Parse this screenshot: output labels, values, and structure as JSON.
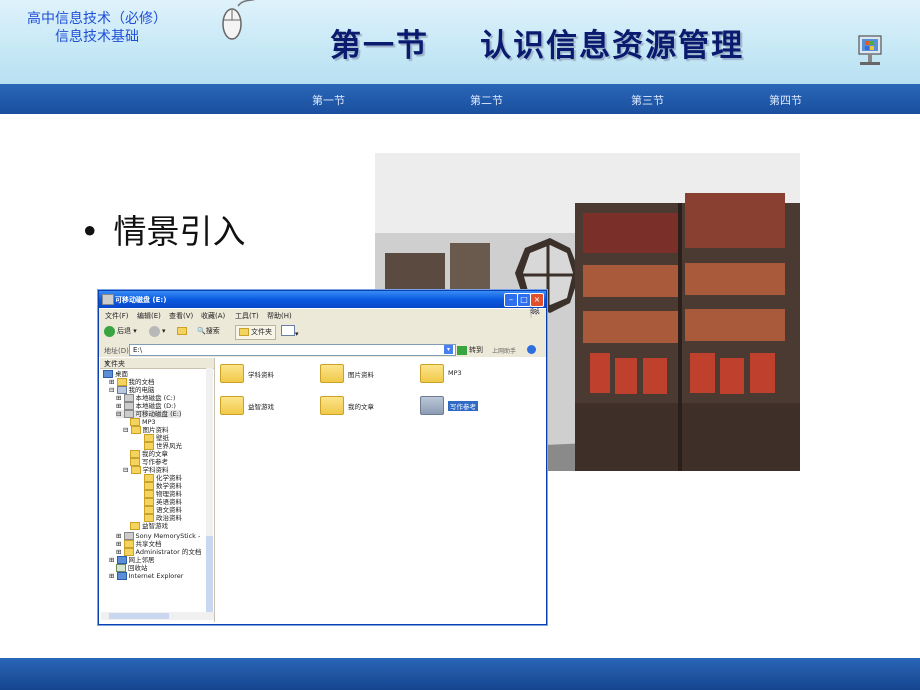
{
  "header": {
    "course_line1": "高中信息技术（必修）",
    "course_line2": "信息技术基础",
    "slide_title": "第一节    认识信息资源管理",
    "mouse_icon": "mouse-icon",
    "computer_icon": "computer-icon"
  },
  "nav": {
    "items": [
      "第一节",
      "第二节",
      "第三节",
      "第四节"
    ]
  },
  "content": {
    "bullet": "情景引入"
  },
  "explorer": {
    "title": "可移动磁盘 (E:)",
    "menu": [
      "文件(F)",
      "编辑(E)",
      "查看(V)",
      "收藏(A)",
      "工具(T)",
      "帮助(H)"
    ],
    "toolbar": {
      "back": "后退",
      "search": "搜索",
      "folders": "文件夹"
    },
    "address_label": "地址(D)",
    "address_value": "E:\\",
    "go_label": "转到",
    "links_label": "上网助手",
    "tree_header": "文件夹",
    "tree": [
      "桌面",
      "我的文档",
      "我的电脑",
      "本地磁盘 (C:)",
      "本地磁盘 (D:)",
      "可移动磁盘 (E:)",
      "MP3",
      "图片资料",
      "壁纸",
      "世界风光",
      "我的文章",
      "写作参考",
      "学科资料",
      "化学资料",
      "数学资料",
      "物理资料",
      "英语资料",
      "语文资料",
      "政治资料",
      "益智游戏",
      "Sony MemoryStick - ",
      "共享文档",
      "Administrator 的文档",
      "网上邻居",
      "回收站",
      "Internet Explorer"
    ],
    "files": [
      "学科资料",
      "图片资料",
      "MP3",
      "益智游戏",
      "我的文章",
      "写作参考"
    ]
  }
}
